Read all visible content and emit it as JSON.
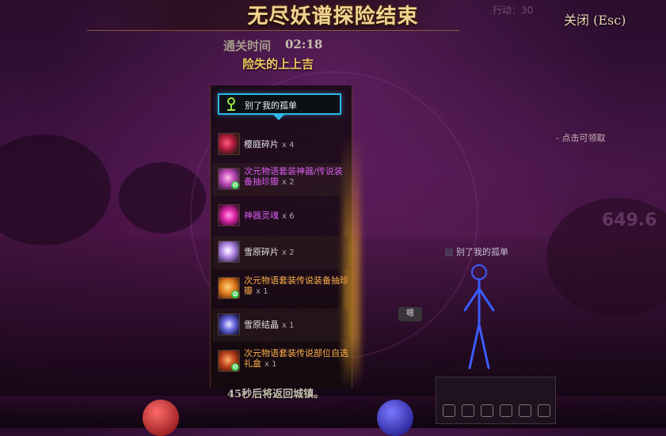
{
  "header": {
    "title": "无尽妖谱探险结束",
    "close_label": "关闭 (Esc)",
    "faded_hud": "行动：30"
  },
  "summary": {
    "clear_time_label": "通关时间",
    "clear_time_value": "02:18",
    "fortune": "险失的上上吉"
  },
  "title_reward": {
    "label": "别了我的孤单",
    "icon": "pin-icon",
    "border_color": "#2fb8e6"
  },
  "rewards": [
    {
      "name": "樱庭碎片",
      "qty": "x 4",
      "rarity": "common",
      "icon": "crystal-shard-icon"
    },
    {
      "name": "次元物语套装神器/传说装备抽珍瓣",
      "qty": "x 2",
      "rarity": "epic",
      "icon": "artifact-chest-icon"
    },
    {
      "name": "神器灵魂",
      "qty": "x 6",
      "rarity": "epic",
      "icon": "artifact-soul-icon"
    },
    {
      "name": "雪原碎片",
      "qty": "x 2",
      "rarity": "common",
      "icon": "snow-shard-icon"
    },
    {
      "name": "次元物语套装传说装备抽珍瓣",
      "qty": "x 1",
      "rarity": "legendary",
      "icon": "legendary-chest-icon"
    },
    {
      "name": "雪原结晶",
      "qty": "x 1",
      "rarity": "common",
      "icon": "snow-crystal-icon"
    },
    {
      "name": "次元物语套装传说部位自选礼盒",
      "qty": "x 1",
      "rarity": "legendary",
      "icon": "gift-box-icon"
    }
  ],
  "footer": {
    "return_message": "45秒后将返回城镇。"
  },
  "scene": {
    "chat_bubble": "嗯",
    "character_name": "别了我的孤单",
    "side_note": "- 点击可领取",
    "damage_number": "649.6"
  },
  "colors": {
    "title_gold": "#f2d493",
    "common": "#e6e6e6",
    "epic": "#d85cf0",
    "legendary": "#ffb14a"
  }
}
